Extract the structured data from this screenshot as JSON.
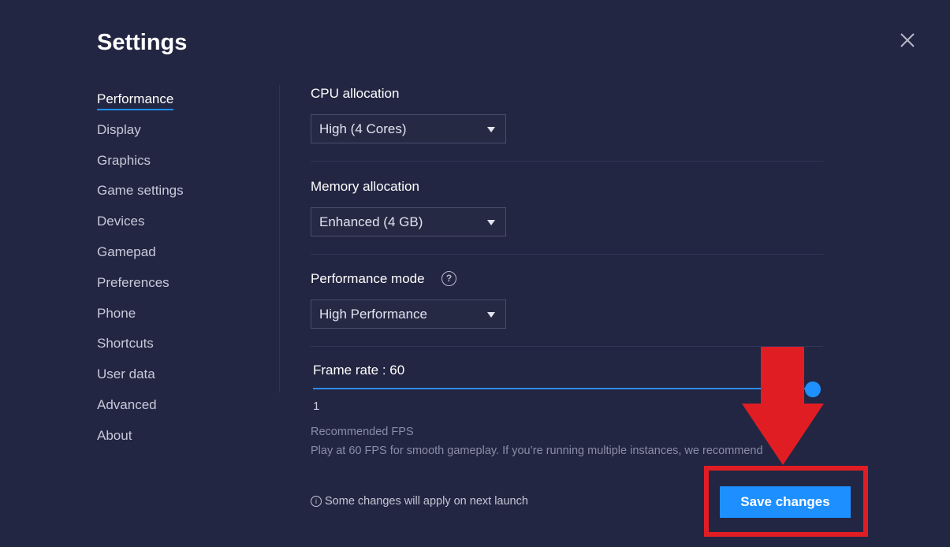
{
  "dialog": {
    "title": "Settings",
    "close_icon": "close-icon"
  },
  "nav": {
    "items": [
      {
        "label": "Performance",
        "active": true
      },
      {
        "label": "Display"
      },
      {
        "label": "Graphics"
      },
      {
        "label": "Game settings"
      },
      {
        "label": "Devices"
      },
      {
        "label": "Gamepad"
      },
      {
        "label": "Preferences"
      },
      {
        "label": "Phone"
      },
      {
        "label": "Shortcuts"
      },
      {
        "label": "User data"
      },
      {
        "label": "Advanced"
      },
      {
        "label": "About"
      }
    ]
  },
  "performance": {
    "cpu": {
      "label": "CPU allocation",
      "value": "High (4 Cores)"
    },
    "memory": {
      "label": "Memory allocation",
      "value": "Enhanced (4 GB)"
    },
    "mode": {
      "label": "Performance mode",
      "value": "High Performance",
      "help_icon": "?"
    },
    "frame_rate": {
      "label": "Frame rate : 60",
      "min_label": "1",
      "level": 1.0
    },
    "recommended": {
      "title": "Recommended FPS",
      "text": "Play at 60 FPS for smooth gameplay. If you’re running multiple instances, we recommend"
    }
  },
  "footer": {
    "note_icon": "i",
    "note": "Some changes will apply on next launch",
    "save_label": "Save changes"
  },
  "colors": {
    "accent": "#1e8fff",
    "background": "#232642",
    "annotation": "#e11d24"
  }
}
